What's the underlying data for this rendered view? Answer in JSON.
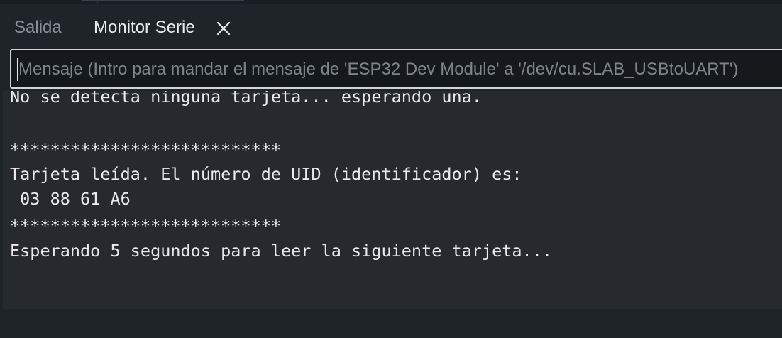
{
  "tabs": [
    {
      "label": "Salida",
      "active": false
    },
    {
      "label": "Monitor Serie",
      "active": true,
      "closable": true
    }
  ],
  "close_icon": "close-icon",
  "message_input": {
    "value": "",
    "placeholder": "Mensaje (Intro para mandar el mensaje de 'ESP32 Dev Module' a '/dev/cu.SLAB_USBtoUART')"
  },
  "output": {
    "lines": [
      "No se detecta ninguna tarjeta... esperando una.",
      "",
      "***************************",
      "Tarjeta leída. El número de UID (identificador) es:",
      " 03 88 61 A6",
      "***************************",
      "Esperando 5 segundos para leer la siguiente tarjeta..."
    ]
  },
  "colors": {
    "background": "#1f2428",
    "output_background": "#262a2e",
    "text": "#e8eaec",
    "muted_text": "#8b9096",
    "input_border": "#d0d4d8"
  }
}
